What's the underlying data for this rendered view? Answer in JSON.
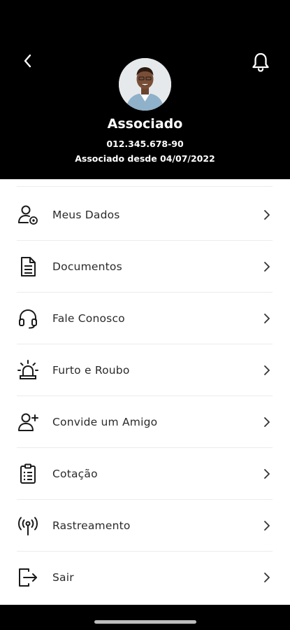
{
  "header": {
    "back_icon": "chevron-left-icon",
    "notification_icon": "bell-icon",
    "user_name": "Associado",
    "cpf": "012.345.678-90",
    "member_since": "Associado desde 04/07/2022",
    "background_color": "#000000",
    "text_color": "#ffffff"
  },
  "menu": {
    "items": [
      {
        "label": "Meus Dados",
        "icon": "user-settings-icon"
      },
      {
        "label": "Documentos",
        "icon": "document-icon"
      },
      {
        "label": "Fale Conosco",
        "icon": "headset-icon"
      },
      {
        "label": "Furto e Roubo",
        "icon": "alarm-siren-icon"
      },
      {
        "label": "Convide um Amigo",
        "icon": "user-add-icon"
      },
      {
        "label": "Cotação",
        "icon": "clipboard-icon"
      },
      {
        "label": "Rastreamento",
        "icon": "antenna-signal-icon"
      },
      {
        "label": "Sair",
        "icon": "logout-icon"
      }
    ],
    "chevron_icon": "chevron-right-icon"
  }
}
